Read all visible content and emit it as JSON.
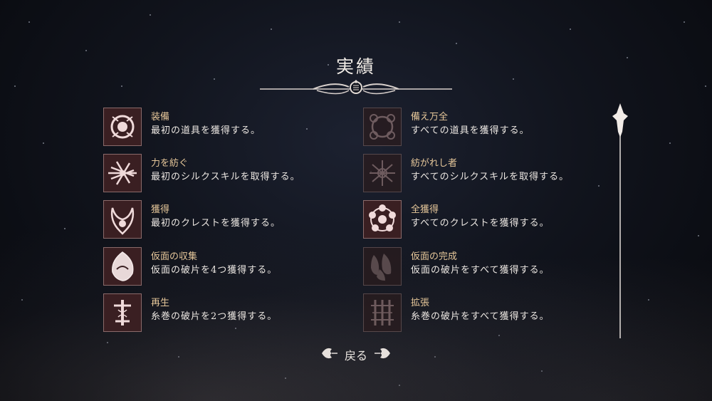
{
  "screen": {
    "title": "実績",
    "back_label": "戻る"
  },
  "achievements_left": [
    {
      "name": "装備",
      "desc": "最初の道具を獲得する。",
      "icon": "gear-crest-icon",
      "unlocked": true
    },
    {
      "name": "力を紡ぐ",
      "desc": "最初のシルクスキルを取得する。",
      "icon": "silk-spikes-icon",
      "unlocked": true
    },
    {
      "name": "獲得",
      "desc": "最初のクレストを獲得する。",
      "icon": "crest-horns-icon",
      "unlocked": true
    },
    {
      "name": "仮面の収集",
      "desc": "仮面の破片を4つ獲得する。",
      "icon": "mask-shard-icon",
      "unlocked": true
    },
    {
      "name": "再生",
      "desc": "糸巻の破片を2つ獲得する。",
      "icon": "spool-needle-icon",
      "unlocked": true
    }
  ],
  "achievements_right": [
    {
      "name": "備え万全",
      "desc": "すべての道具を獲得する。",
      "icon": "all-tools-icon",
      "unlocked": false
    },
    {
      "name": "紡がれし者",
      "desc": "すべてのシルクスキルを取得する。",
      "icon": "all-silk-skills-icon",
      "unlocked": false
    },
    {
      "name": "全獲得",
      "desc": "すべてのクレストを獲得する。",
      "icon": "all-crests-icon",
      "unlocked": true
    },
    {
      "name": "仮面の完成",
      "desc": "仮面の破片をすべて獲得する。",
      "icon": "all-masks-icon",
      "unlocked": false
    },
    {
      "name": "拡張",
      "desc": "糸巻の破片をすべて獲得する。",
      "icon": "all-spools-icon",
      "unlocked": false
    }
  ],
  "colors": {
    "accent_name": "#e6c79a",
    "icon_frame": "#8a6a6a",
    "icon_bg": "#3a1f22"
  }
}
